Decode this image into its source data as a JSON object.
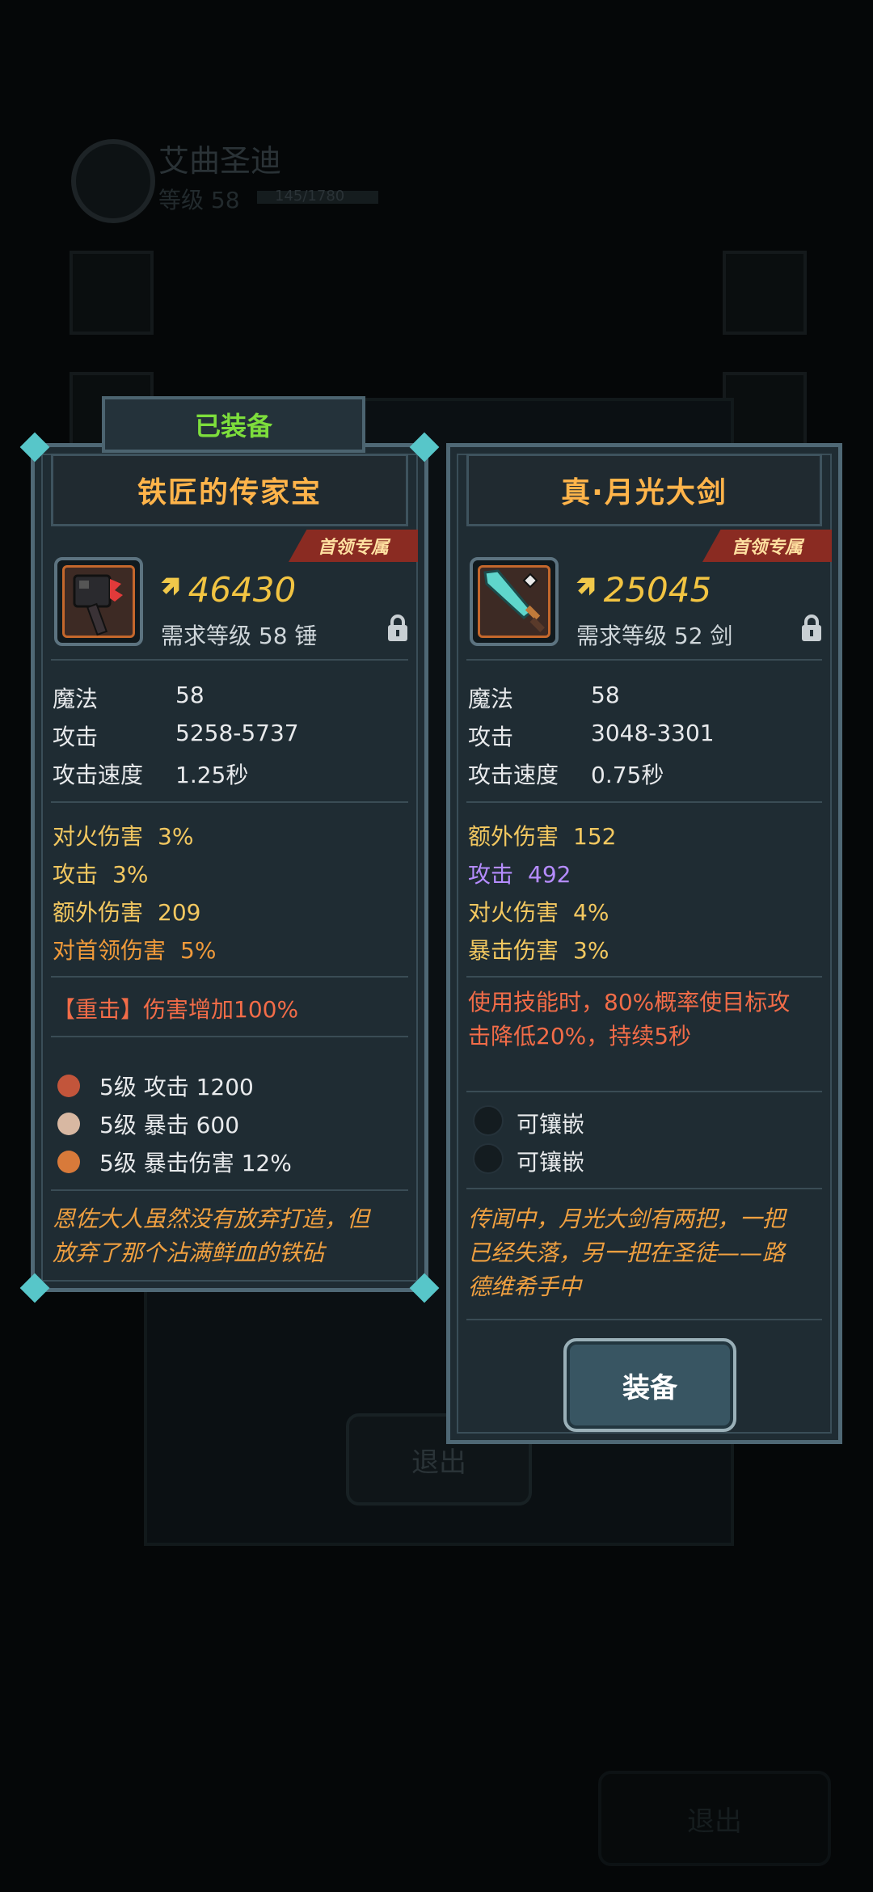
{
  "background": {
    "player_name": "艾曲圣迪",
    "level_text": "等级 58",
    "exp_text": "145/1780",
    "exit_label": "退出",
    "exit_label_2": "退出"
  },
  "left_card": {
    "equipped_tab": "已装备",
    "name": "铁匠的传家宝",
    "boss_tag": "首领专属",
    "power": "46430",
    "requirement": "需求等级 58   锤",
    "base_stats": [
      {
        "k": "魔法",
        "v": "58"
      },
      {
        "k": "攻击",
        "v": "5258-5737"
      },
      {
        "k": "攻击速度",
        "v": "1.25秒"
      }
    ],
    "bonus_stats": [
      {
        "k": "对火伤害",
        "v": "3%"
      },
      {
        "k": "攻击",
        "v": "3%"
      },
      {
        "k": "额外伤害",
        "v": "209"
      },
      {
        "k": "对首领伤害",
        "v": "5%"
      }
    ],
    "skill": "【重击】伤害增加100%",
    "gems": [
      {
        "text": "5级   攻击 1200",
        "color": "#c2553b"
      },
      {
        "text": "5级   暴击 600",
        "color": "#d8b8a2"
      },
      {
        "text": "5级   暴击伤害 12%",
        "color": "#d87a3a"
      }
    ],
    "lore_lines": [
      "恩佐大人虽然没有放弃打造，但",
      "放弃了那个沾满鲜血的铁砧"
    ]
  },
  "right_card": {
    "name": "真·月光大剑",
    "boss_tag": "首领专属",
    "power": "25045",
    "requirement": "需求等级 52   剑",
    "base_stats": [
      {
        "k": "魔法",
        "v": "58"
      },
      {
        "k": "攻击",
        "v": "3048-3301"
      },
      {
        "k": "攻击速度",
        "v": "0.75秒"
      }
    ],
    "bonus_stats": [
      {
        "k": "额外伤害",
        "v": "152"
      },
      {
        "k": "攻击",
        "v": "492"
      },
      {
        "k": "对火伤害",
        "v": "4%"
      },
      {
        "k": "暴击伤害",
        "v": "3%"
      }
    ],
    "skill_lines": [
      "使用技能时，80%概率使目标攻",
      "击降低20%，持续5秒"
    ],
    "sockets": [
      "可镶嵌",
      "可镶嵌"
    ],
    "lore_lines": [
      "传闻中，月光大剑有两把，一把",
      "已经失落，另一把在圣徒——路",
      "德维希手中"
    ],
    "equip_label": "装备"
  },
  "colors": {
    "gold": "#f3c860",
    "title": "#ffb44a",
    "purple_stat": "#b58cff",
    "skill_red": "#f26c48",
    "lore_orange": "#f09a3a",
    "equipped_green": "#7dde3c"
  }
}
